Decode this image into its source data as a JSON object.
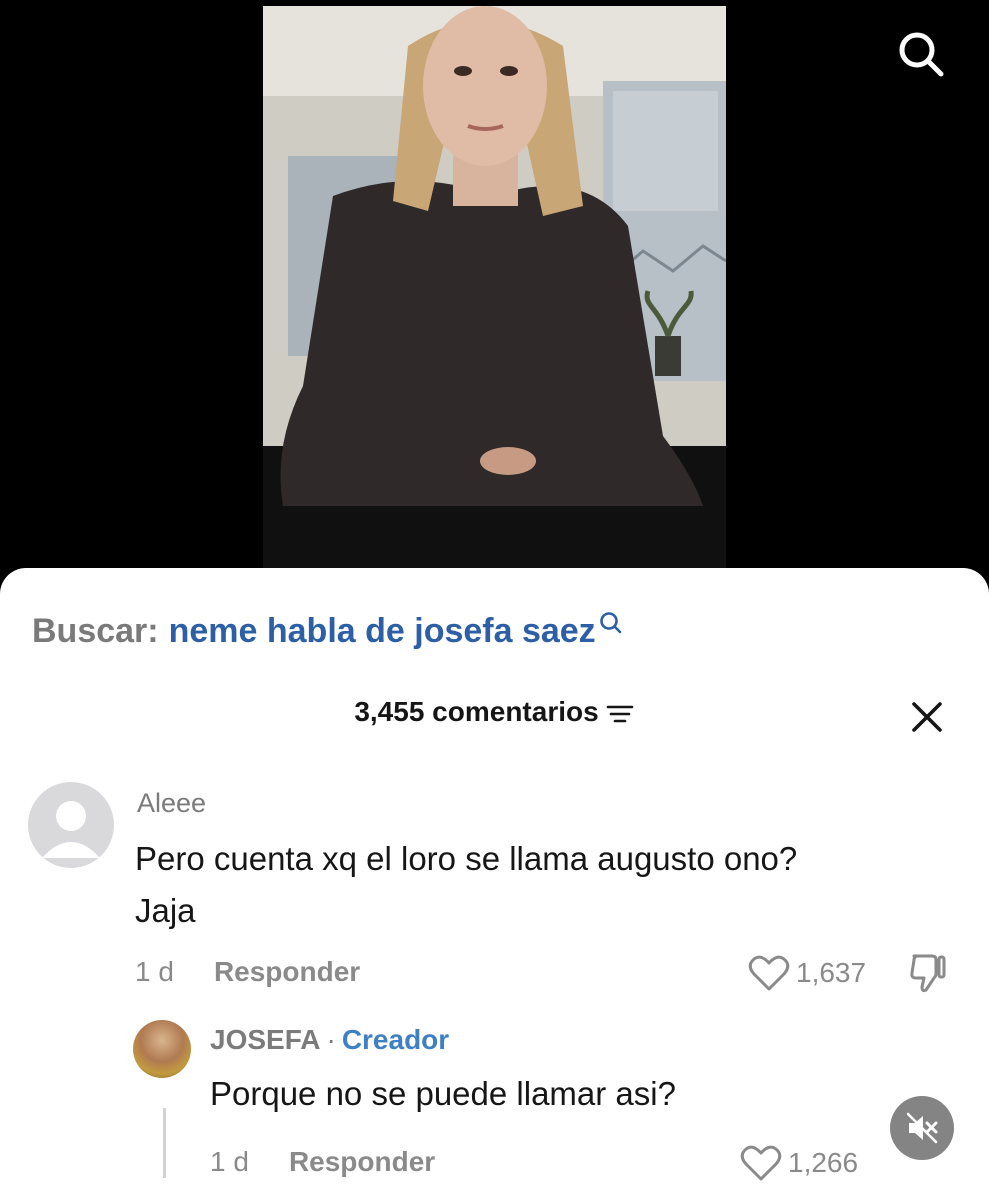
{
  "search": {
    "prefix": "Buscar:",
    "query": "neme habla de josefa saez"
  },
  "comments": {
    "count_label": "3,455 comentarios",
    "items": [
      {
        "username": "Aleee",
        "text_line1": "Pero cuenta xq el loro se llama augusto ono?",
        "text_line2": "Jaja",
        "age": "1 d",
        "reply_label": "Responder",
        "likes": "1,637"
      }
    ],
    "reply": {
      "username": "JOSEFA",
      "separator": "·",
      "badge": "Creador",
      "text": "Porque no se puede llamar asi?",
      "age": "1 d",
      "reply_label": "Responder",
      "likes": "1,266"
    }
  },
  "colors": {
    "link_blue": "#2d5fa6",
    "creator_blue": "#3f7fc4",
    "muted_text": "#8a8a8a"
  },
  "icons": [
    "search-icon",
    "sort-icon",
    "close-icon",
    "heart-icon",
    "dislike-icon",
    "mute-icon"
  ]
}
